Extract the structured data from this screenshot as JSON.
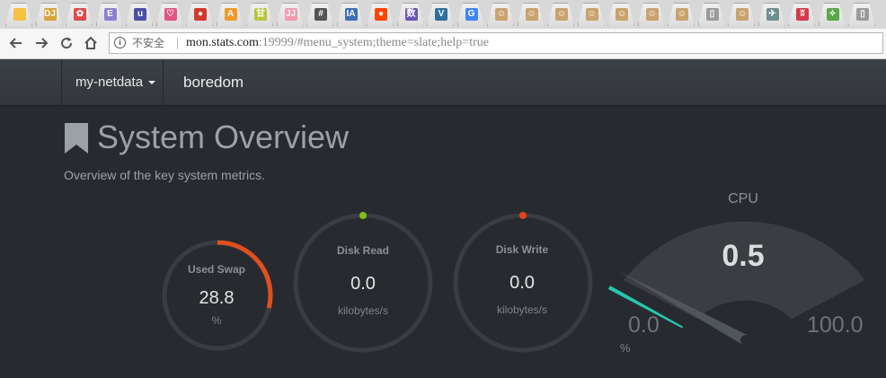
{
  "browser": {
    "tabs": [
      {
        "icon": "chat-icon",
        "color": "#f4c142",
        "glyph": ""
      },
      {
        "icon": "dj-icon",
        "color": "#d7a33a",
        "glyph": "DJ"
      },
      {
        "icon": "paw-icon",
        "color": "#e04a4a",
        "glyph": "✿"
      },
      {
        "icon": "e-icon",
        "color": "#8a7fd1",
        "glyph": "E"
      },
      {
        "icon": "u-icon",
        "color": "#4c4fa8",
        "glyph": "u"
      },
      {
        "icon": "heart-icon",
        "color": "#e05585",
        "glyph": "♡"
      },
      {
        "icon": "red-ball-icon",
        "color": "#d33a2c",
        "glyph": "●"
      },
      {
        "icon": "a-icon",
        "color": "#f09a2b",
        "glyph": "A"
      },
      {
        "icon": "hanzi-icon",
        "color": "#b7c540",
        "glyph": "甘"
      },
      {
        "icon": "jj-icon",
        "color": "#f19ab0",
        "glyph": "JJ"
      },
      {
        "icon": "hash-icon",
        "color": "#555555",
        "glyph": "#"
      },
      {
        "icon": "ia-icon",
        "color": "#3f6fb3",
        "glyph": "IA"
      },
      {
        "icon": "reddit-icon",
        "color": "#ff4500",
        "glyph": "●"
      },
      {
        "icon": "shu-icon",
        "color": "#6a55b0",
        "glyph": "数"
      },
      {
        "icon": "v-icon",
        "color": "#2f6f9f",
        "glyph": "V"
      },
      {
        "icon": "google-icon",
        "color": "#4285f4",
        "glyph": "G"
      },
      {
        "icon": "face-icon",
        "color": "#c9a36e",
        "glyph": "☺"
      },
      {
        "icon": "face-icon",
        "color": "#c9a36e",
        "glyph": "☺"
      },
      {
        "icon": "face-icon",
        "color": "#c9a36e",
        "glyph": "☺"
      },
      {
        "icon": "face-icon",
        "color": "#c9a36e",
        "glyph": "☺"
      },
      {
        "icon": "face-icon",
        "color": "#c9a36e",
        "glyph": "☺"
      },
      {
        "icon": "face-icon",
        "color": "#c9a36e",
        "glyph": "☺"
      },
      {
        "icon": "face-icon",
        "color": "#c9a36e",
        "glyph": "☺"
      },
      {
        "icon": "page-icon",
        "color": "#9a9a9a",
        "glyph": "▯"
      },
      {
        "icon": "face-icon",
        "color": "#c9a36e",
        "glyph": "☺"
      },
      {
        "icon": "bird-icon",
        "color": "#6f8f8f",
        "glyph": "✈"
      },
      {
        "icon": "bow-icon",
        "color": "#d43a4a",
        "glyph": "ʬ"
      },
      {
        "icon": "runner-icon",
        "color": "#5aa84a",
        "glyph": "✧"
      },
      {
        "icon": "page-icon",
        "color": "#9a9a9a",
        "glyph": "▯"
      }
    ],
    "security_label": "不安全",
    "url_host": "mon.stats.com",
    "url_rest": ":19999/#menu_system;theme=slate;help=true"
  },
  "navbar": {
    "brand": "my-netdata",
    "host": "boredom"
  },
  "page": {
    "title": "System Overview",
    "subtitle": "Overview of the key system metrics."
  },
  "gauges": {
    "swap": {
      "label": "Used Swap",
      "value": "28.8",
      "unit": "%",
      "fraction": 0.288,
      "color": "#e0501e"
    },
    "disk_read": {
      "label": "Disk Read",
      "value": "0.0",
      "unit": "kilobytes/s",
      "color": "#7fbf17"
    },
    "disk_write": {
      "label": "Disk Write",
      "value": "0.0",
      "unit": "kilobytes/s",
      "color": "#e8411d"
    },
    "cpu": {
      "title": "CPU",
      "value": "0.5",
      "min": "0.0",
      "max": "100.0",
      "unit": "%",
      "fraction": 0.005,
      "color": "#27c6b0"
    }
  },
  "colors": {
    "background": "#272b30",
    "ring": "#393d42",
    "gauge_fill": "#3a3e43"
  }
}
